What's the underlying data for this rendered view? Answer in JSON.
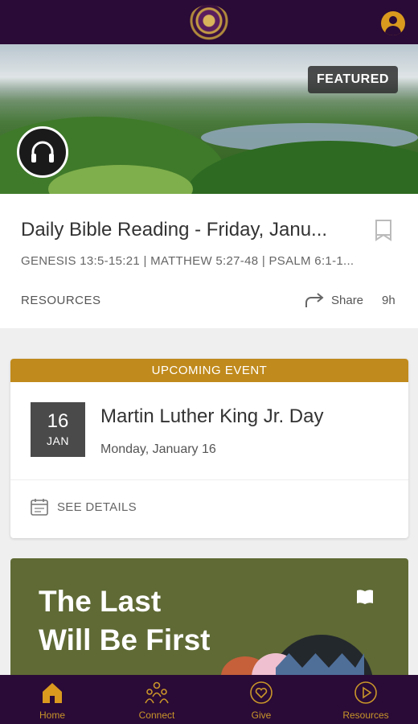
{
  "colors": {
    "brand_purple": "#2a0a36",
    "accent_gold": "#c9962a",
    "event_header": "#c08a1c",
    "promo_green": "#5f6a35"
  },
  "featured": {
    "badge": "FEATURED",
    "title": "Daily Bible Reading - Friday, Janu...",
    "references": "GENESIS 13:5-15:21 | MATTHEW 5:27-48 | PSALM 6:1-1...",
    "category": "RESOURCES",
    "share_label": "Share",
    "time_ago": "9h"
  },
  "event": {
    "header": "UPCOMING EVENT",
    "day": "16",
    "month": "JAN",
    "title": "Martin Luther King Jr. Day",
    "date_text": "Monday, January 16",
    "details_label": "SEE DETAILS"
  },
  "promo": {
    "title_line1": "The Last",
    "title_line2": "Will Be First"
  },
  "tabs": [
    {
      "label": "Home",
      "icon": "home-icon"
    },
    {
      "label": "Connect",
      "icon": "people-icon"
    },
    {
      "label": "Give",
      "icon": "heart-icon"
    },
    {
      "label": "Resources",
      "icon": "play-icon"
    }
  ]
}
